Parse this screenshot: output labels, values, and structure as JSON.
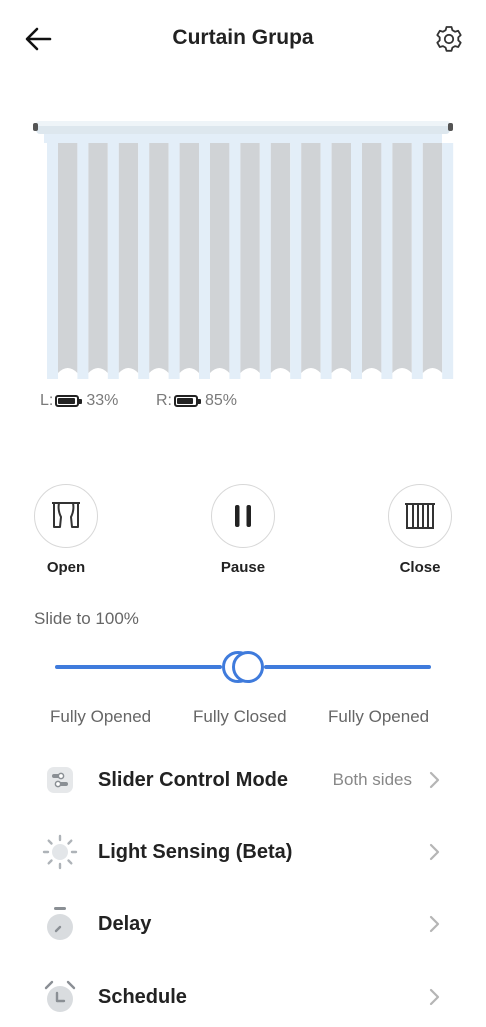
{
  "header": {
    "title": "Curtain Grupa"
  },
  "battery": {
    "left": {
      "prefix": "L:",
      "percent_text": "33%",
      "level": 0.9
    },
    "right": {
      "prefix": "R:",
      "percent_text": "85%",
      "level": 0.9
    }
  },
  "controls": [
    {
      "label": "Open",
      "icon": "curtain-open-icon"
    },
    {
      "label": "Pause",
      "icon": "pause-icon"
    },
    {
      "label": "Close",
      "icon": "curtain-close-icon"
    }
  ],
  "slider": {
    "caption": "Slide to 100%",
    "left_value_percent": 100,
    "right_value_percent": 100,
    "labels": {
      "left": "Fully Opened",
      "center": "Fully Closed",
      "right": "Fully Opened"
    }
  },
  "menu": [
    {
      "label": "Slider Control Mode",
      "value": "Both sides",
      "icon": "slider-mode-icon"
    },
    {
      "label": "Light Sensing (Beta)",
      "value": "",
      "icon": "sun-icon"
    },
    {
      "label": "Delay",
      "value": "",
      "icon": "timer-icon"
    },
    {
      "label": "Schedule",
      "value": "",
      "icon": "alarm-clock-icon"
    }
  ],
  "colors": {
    "accent": "#3f7bdc",
    "curtain_fold": "#d0d3d6",
    "curtain_light": "#e3eef8"
  }
}
